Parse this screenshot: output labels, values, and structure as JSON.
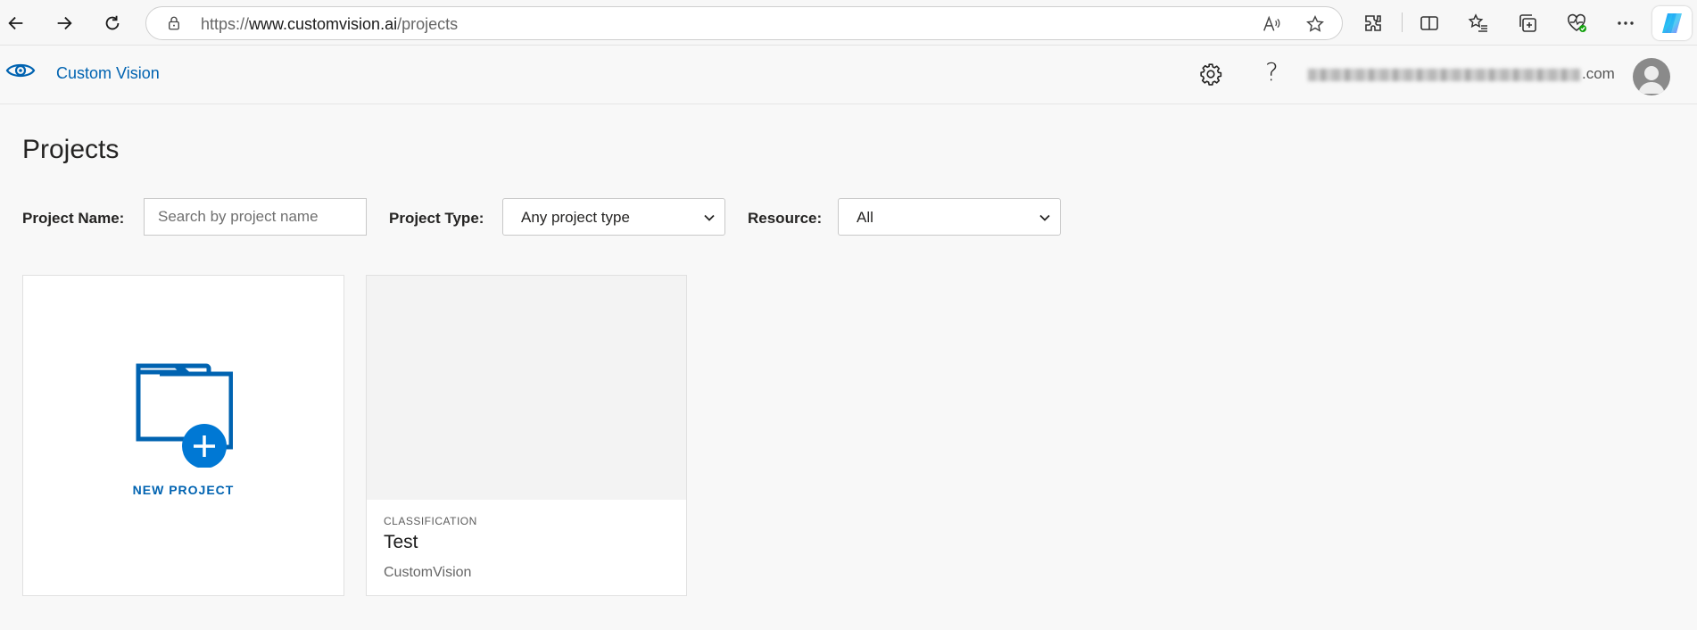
{
  "browser": {
    "url_prefix": "https://",
    "url_host": "www.customvision.ai",
    "url_path": "/projects"
  },
  "header": {
    "app_title": "Custom Vision",
    "help_label": "?",
    "email_suffix": ".com"
  },
  "page": {
    "title": "Projects"
  },
  "filters": {
    "project_name_label": "Project Name:",
    "project_name_placeholder": "Search by project name",
    "project_type_label": "Project Type:",
    "project_type_value": "Any project type",
    "resource_label": "Resource:",
    "resource_value": "All"
  },
  "new_project": {
    "label": "NEW PROJECT"
  },
  "projects": [
    {
      "type": "CLASSIFICATION",
      "name": "Test",
      "resource": "CustomVision"
    }
  ],
  "colors": {
    "brand_blue": "#0063b1",
    "accent_blue": "#0078d4"
  }
}
